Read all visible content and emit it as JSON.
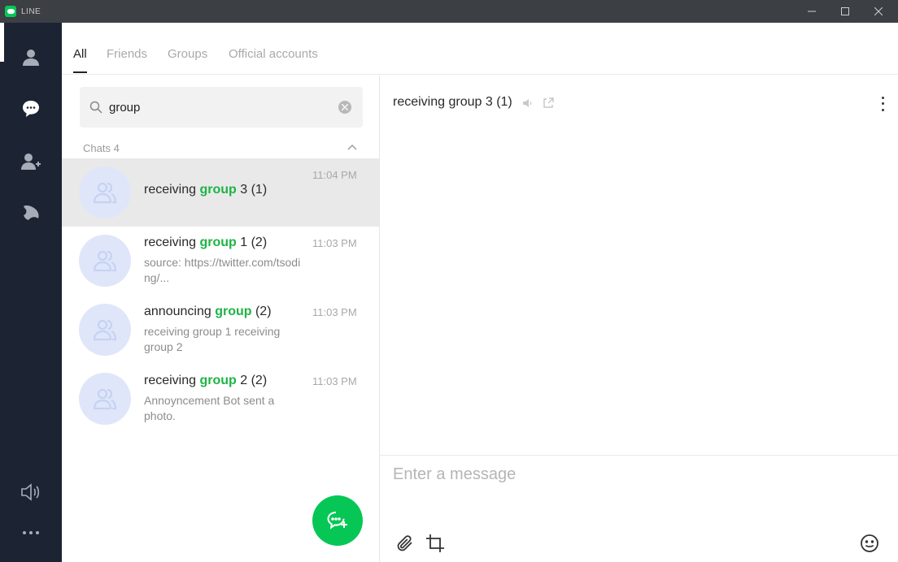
{
  "window": {
    "title": "LINE"
  },
  "nav": {
    "items": [
      {
        "name": "friends",
        "icon": "person-icon"
      },
      {
        "name": "chats",
        "icon": "chat-bubble-icon"
      },
      {
        "name": "add-friends",
        "icon": "add-person-icon"
      },
      {
        "name": "timeline",
        "icon": "timeline-icon"
      }
    ],
    "bottom": [
      {
        "name": "notifications",
        "icon": "speaker-icon"
      },
      {
        "name": "more",
        "icon": "more-horizontal-icon"
      }
    ]
  },
  "tabs": [
    "All",
    "Friends",
    "Groups",
    "Official accounts"
  ],
  "active_tab": "All",
  "search": {
    "value": "group"
  },
  "section": {
    "label": "Chats 4"
  },
  "chats": [
    {
      "prefix": "receiving ",
      "highlight": "group",
      "suffix": " 3 (1)",
      "time": "11:04 PM",
      "preview": ""
    },
    {
      "prefix": "receiving ",
      "highlight": "group",
      "suffix": " 1 (2)",
      "time": "11:03 PM",
      "preview": "source: https://twitter.com/tsoding/..."
    },
    {
      "prefix": "announcing ",
      "highlight": "group",
      "suffix": " (2)",
      "time": "11:03 PM",
      "preview": "receiving group 1 receiving group 2"
    },
    {
      "prefix": "receiving ",
      "highlight": "group",
      "suffix": " 2 (2)",
      "time": "11:03 PM",
      "preview": "Annoyncement Bot sent a photo."
    }
  ],
  "conversation": {
    "title": "receiving group 3 (1)",
    "composer_placeholder": "Enter a message"
  },
  "colors": {
    "brand_green": "#06c755",
    "highlight_green": "#1db446",
    "nav_bg": "#1c2433"
  }
}
